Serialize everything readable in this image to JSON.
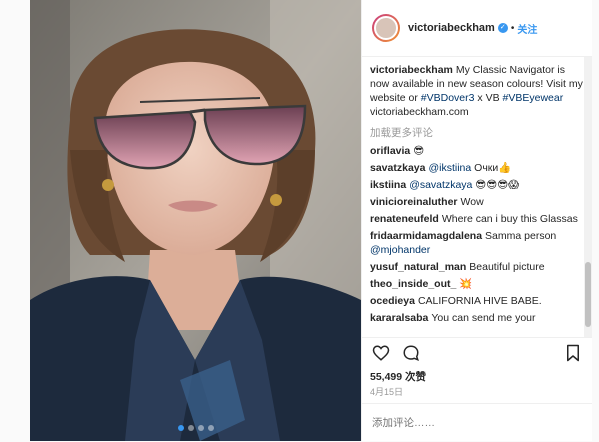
{
  "post": {
    "username": "victoriabeckham",
    "follow_label": "关注",
    "separator": "•",
    "caption_user": "victoriabeckham",
    "caption_parts": [
      "My Classic Navigator is now available in new season colours! Visit my website or ",
      "#VBDover3",
      " x VB ",
      "#VBEyewear",
      " victoriabeckham.com"
    ],
    "load_more": "加载更多评论",
    "comments": [
      {
        "user": "oriflavia",
        "text": "😎"
      },
      {
        "user": "savatzkaya",
        "mention": "@ikstiina",
        "text": "Очки👍"
      },
      {
        "user": "ikstiina",
        "mention": "@savatzkaya",
        "text": "😎😎😎😱"
      },
      {
        "user": "vinicioreinaluther",
        "text": "Wow"
      },
      {
        "user": "renateneufeld",
        "text": "Where can i buy this Glassas"
      },
      {
        "user": "fridaarmidamagdalena",
        "text": "Samma person",
        "mention_after": "@mjohander"
      },
      {
        "user": "yusuf_natural_man",
        "text": "Beautiful picture"
      },
      {
        "user": "theo_inside_out_",
        "text": "💥"
      },
      {
        "user": "ocedieya",
        "text": "CALIFORNIA HIVE BABE."
      },
      {
        "user": "kararalsaba",
        "text": "You can send me your"
      }
    ],
    "likes": "55,499 次赞",
    "date": "4月15日",
    "add_comment_placeholder": "添加评论……"
  },
  "icons": [
    "heart-icon",
    "comment-icon",
    "bookmark-icon",
    "verified-icon",
    "more-icon"
  ],
  "colors": {
    "link": "#3897f0",
    "hashtag": "#003569",
    "muted": "#999999"
  }
}
